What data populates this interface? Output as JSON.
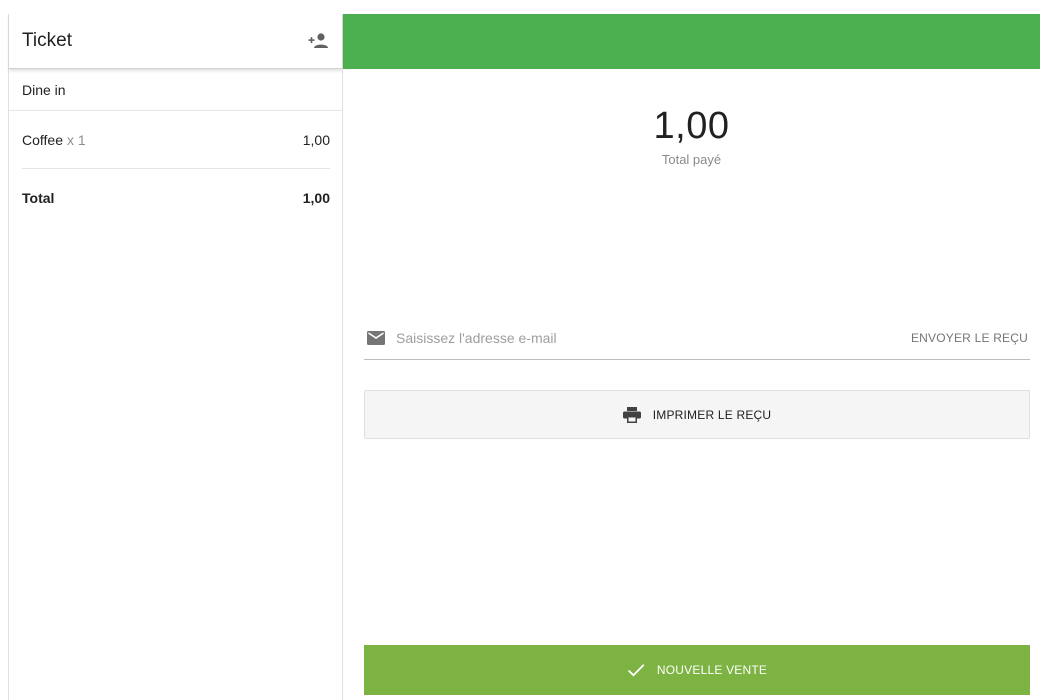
{
  "ticket": {
    "title": "Ticket",
    "add_customer_icon": "person-add-icon",
    "dining_option": "Dine in",
    "items": [
      {
        "name": "Coffee",
        "qty": "x 1",
        "price": "1,00"
      }
    ],
    "total_label": "Total",
    "total_value": "1,00"
  },
  "payment": {
    "amount": "1,00",
    "amount_label": "Total payé"
  },
  "email": {
    "icon": "mail-icon",
    "placeholder": "Saisissez l'adresse e-mail",
    "value": "",
    "send_label": "ENVOYER LE REÇU"
  },
  "print": {
    "icon": "printer-icon",
    "label": "IMPRIMER LE REÇU"
  },
  "new_sale": {
    "icon": "check-icon",
    "label": "NOUVELLE VENTE"
  },
  "colors": {
    "header_green": "#4caf50",
    "button_green": "#7cb342",
    "print_bg": "#f5f5f5"
  }
}
